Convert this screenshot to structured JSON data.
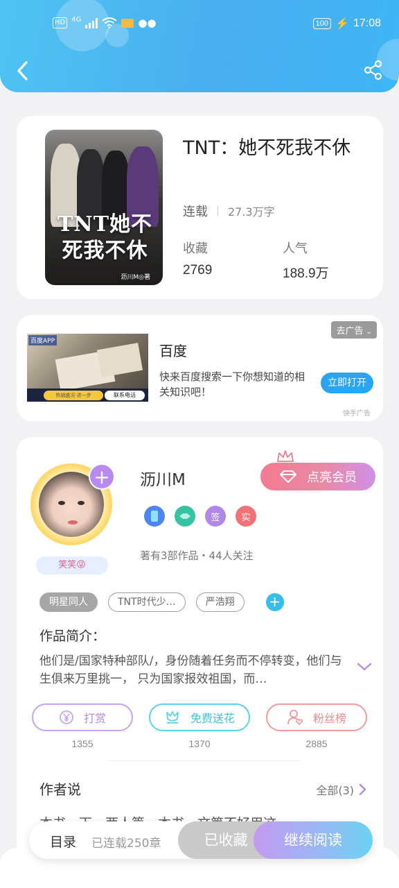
{
  "status_bar": {
    "hd": "HD",
    "network": "4G",
    "battery": "100",
    "time": "17:08"
  },
  "header": {
    "back_icon": "chevron-left-icon",
    "share_icon": "share-icon",
    "accent": "#4aaef0"
  },
  "book": {
    "title": "TNT：她不死我不休",
    "cover_title": "TNT她不死我不休",
    "cover_author": "沥川M◎著",
    "status": "连载",
    "word_count": "27.3万字",
    "collect_label": "收藏",
    "collect_value": "2769",
    "popularity_label": "人气",
    "popularity_value": "188.9万"
  },
  "ad": {
    "image_tag": "百度APP",
    "image_button_a": "热销盛况·进一步",
    "image_button_b": "联系电话",
    "title": "百度",
    "description": "快来百度搜索一下你想知道的相关知识吧！",
    "remove_label": "去广告",
    "open_label": "立即打开",
    "source": "快手广告"
  },
  "author": {
    "name": "沥川M",
    "badge_text": "笑笑😜",
    "vip_label": "点亮会员",
    "badges": [
      "phone-badge-icon",
      "handshake-badge-icon",
      "签",
      "实"
    ],
    "stats": "著有3部作品・44人关注"
  },
  "tags": [
    "明星同人",
    "TNT时代少…",
    "严浩翔"
  ],
  "intro": {
    "label": "作品简介：",
    "text": "他们是/国家特种部队/，身份随着任务而不停转变，他们与生俱来万里挑一， 只为国家报效祖国，而…"
  },
  "actions": [
    {
      "label": "打赏",
      "count": "1355",
      "icon": "yen-coin-icon",
      "color": "#c5a3ee"
    },
    {
      "label": "免费送花",
      "count": "1370",
      "icon": "flower-icon",
      "color": "#58d2e8"
    },
    {
      "label": "粉丝榜",
      "count": "2885",
      "icon": "user-heart-icon",
      "color": "#f09a9e"
    }
  ],
  "author_says": {
    "title": "作者说",
    "all_label": "全部(3)",
    "peek": "本书一下一两人篇一本书一文第不好用这"
  },
  "bottom_bar": {
    "toc": "目录",
    "chapters": "已连载250章",
    "collected": "已收藏",
    "read": "继续阅读"
  }
}
